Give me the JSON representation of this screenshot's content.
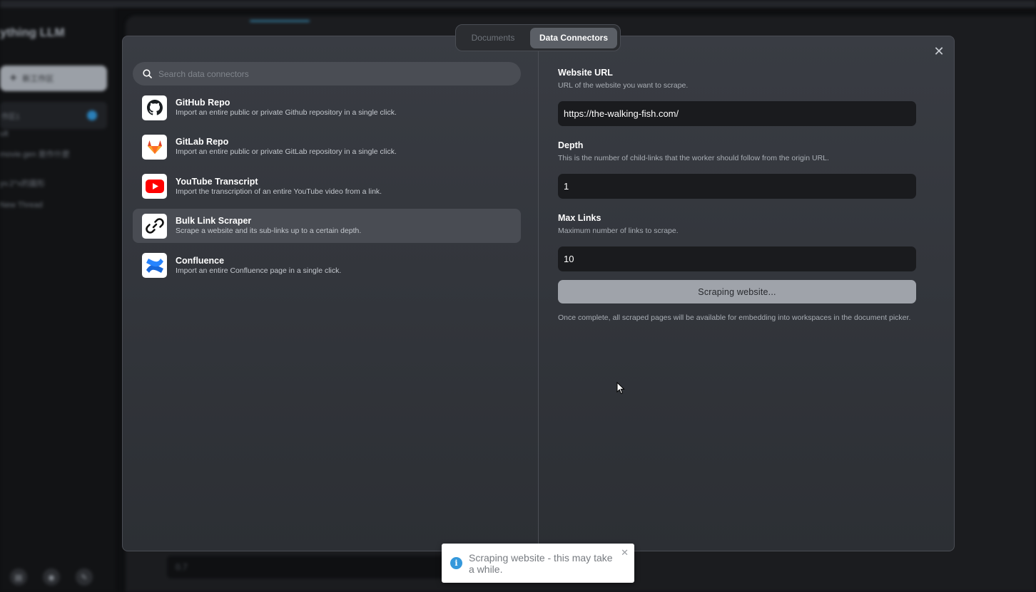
{
  "background": {
    "brand": "ything LLM",
    "new_workspace_label": "新工作区",
    "workspace_name": "作区1",
    "threads": [
      "ult",
      "movie.gen 是作什麼",
      "yv.2^x的圖形",
      "New Thread"
    ],
    "bottom_input_value": "0.7",
    "bottom_icons": [
      "book-icon",
      "discord-icon",
      "wrench-icon"
    ]
  },
  "modal": {
    "tabs": [
      {
        "label": "Documents",
        "active": false
      },
      {
        "label": "Data Connectors",
        "active": true
      }
    ],
    "close_symbol": "✕",
    "search": {
      "placeholder": "Search data connectors"
    },
    "connectors": [
      {
        "title": "GitHub Repo",
        "description": "Import an entire public or private Github repository in a single click.",
        "icon": "github-icon",
        "selected": false
      },
      {
        "title": "GitLab Repo",
        "description": "Import an entire public or private GitLab repository in a single click.",
        "icon": "gitlab-icon",
        "selected": false
      },
      {
        "title": "YouTube Transcript",
        "description": "Import the transcription of an entire YouTube video from a link.",
        "icon": "youtube-icon",
        "selected": false
      },
      {
        "title": "Bulk Link Scraper",
        "description": "Scrape a website and its sub-links up to a certain depth.",
        "icon": "link-icon",
        "selected": true
      },
      {
        "title": "Confluence",
        "description": "Import an entire Confluence page in a single click.",
        "icon": "confluence-icon",
        "selected": false
      }
    ],
    "form": {
      "url": {
        "label": "Website URL",
        "help": "URL of the website you want to scrape.",
        "value": "https://the-walking-fish.com/"
      },
      "depth": {
        "label": "Depth",
        "help": "This is the number of child-links that the worker should follow from the origin URL.",
        "value": "1"
      },
      "max_links": {
        "label": "Max Links",
        "help": "Maximum number of links to scrape.",
        "value": "10"
      },
      "submit_label": "Scraping website...",
      "note": "Once complete, all scraped pages will be available for embedding into workspaces in the document picker."
    }
  },
  "toast": {
    "message": "Scraping website - this may take a while.",
    "icon": "info-icon",
    "icon_glyph": "i",
    "close_symbol": "✕",
    "accent": "#3498db"
  }
}
